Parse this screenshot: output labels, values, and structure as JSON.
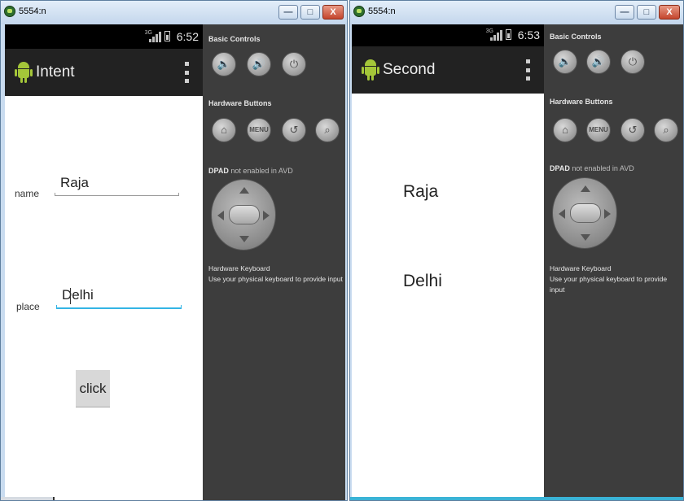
{
  "left_window": {
    "title": "5554:n",
    "controls": {
      "minimize": "—",
      "maximize": "□",
      "close": "X"
    },
    "status": {
      "network": "3G",
      "time": "6:52"
    },
    "actionbar": {
      "title": "Intent",
      "icon": "android-robot-icon",
      "menu_icon": "overflow-menu-icon"
    },
    "form": {
      "name_label": "name",
      "name_value": "Raja",
      "place_label": "place",
      "place_value": "Delhi",
      "click_label": "click"
    }
  },
  "right_window": {
    "title": "5554:n",
    "controls": {
      "minimize": "—",
      "maximize": "□",
      "close": "X"
    },
    "status": {
      "network": "3G",
      "time": "6:53"
    },
    "actionbar": {
      "title": "Second",
      "icon": "android-robot-icon",
      "menu_icon": "overflow-menu-icon"
    },
    "display": {
      "name_value": "Raja",
      "place_value": "Delhi"
    }
  },
  "controls_panel": {
    "basic_controls": "Basic Controls",
    "hardware_buttons": "Hardware Buttons",
    "menu_label": "MENU",
    "dpad_prefix": "DPAD",
    "dpad_note": "not enabled in AVD",
    "keyboard_title": "Hardware Keyboard",
    "keyboard_note": "Use your physical keyboard to provide input"
  },
  "colors": {
    "accent": "#33b5e5",
    "actionbar": "#222222",
    "panel": "#3d3d3d",
    "android_green": "#a4c639"
  }
}
